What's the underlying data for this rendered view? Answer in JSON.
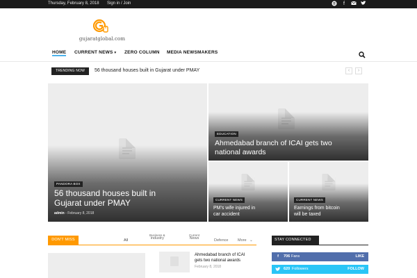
{
  "topbar": {
    "date": "Thursday, February 8, 2018",
    "signin": "Sign in / Join",
    "social_icons": [
      "blogger-icon",
      "facebook-icon",
      "mail-icon",
      "twitter-icon"
    ]
  },
  "logo": {
    "text": "gujaratglobal.com"
  },
  "nav": {
    "items": [
      "HOME",
      "CURRENT NEWS",
      "ZERO COLUMN",
      "MEDIA NEWSMAKERS"
    ],
    "active_index": 0,
    "chevron": "▾"
  },
  "trending": {
    "badge": "TRENDING NOW",
    "title": "56 thousand houses built in Gujarat under PMAY",
    "prev": "‹",
    "next": "›"
  },
  "featured": {
    "main": {
      "category": "PANDORA BOX",
      "title_line1": "56 thousand houses built in",
      "title_line2": "Gujarat under PMAY",
      "author": "admin",
      "separator": "-",
      "date": "February 8, 2018"
    },
    "top_right": {
      "category": "EDUCATION",
      "title_line1": "Ahmedabad branch of ICAI gets two",
      "title_line2": "national awards"
    },
    "bottom_left": {
      "category": "CURRENT NEWS",
      "title_line1": "PM's wife injured in",
      "title_line2": "car accident"
    },
    "bottom_right": {
      "category": "CURRENT NEWS",
      "title_line1": "Earnings from bitcoin",
      "title_line2": "will be taxed"
    }
  },
  "dont_miss": {
    "badge": "DON'T MISS",
    "filters": {
      "all": "All",
      "business_line1": "Business &",
      "business_line2": "industry",
      "current_line1": "Current",
      "current_line2": "News",
      "defence": "Defence",
      "more": "More",
      "more_chevron": "⌄"
    },
    "article": {
      "title_line1": "Ahmedabad branch of ICAI",
      "title_line2": "gets two national awards",
      "date": "February 8, 2018"
    }
  },
  "stay_connected": {
    "badge": "STAY CONNECTED",
    "rows": [
      {
        "icon": "f",
        "count": "706",
        "label": "Fans",
        "action": "LIKE",
        "color": "#516eab"
      },
      {
        "icon": "t",
        "count": "620",
        "label": "Followers",
        "action": "FOLLOW",
        "color": "#29c5f6"
      }
    ]
  },
  "colors": {
    "accent": "#4db2ec",
    "dont_miss": "#ff9900",
    "facebook": "#516eab",
    "twitter": "#29c5f6",
    "topbar": "#1a1a1a"
  }
}
